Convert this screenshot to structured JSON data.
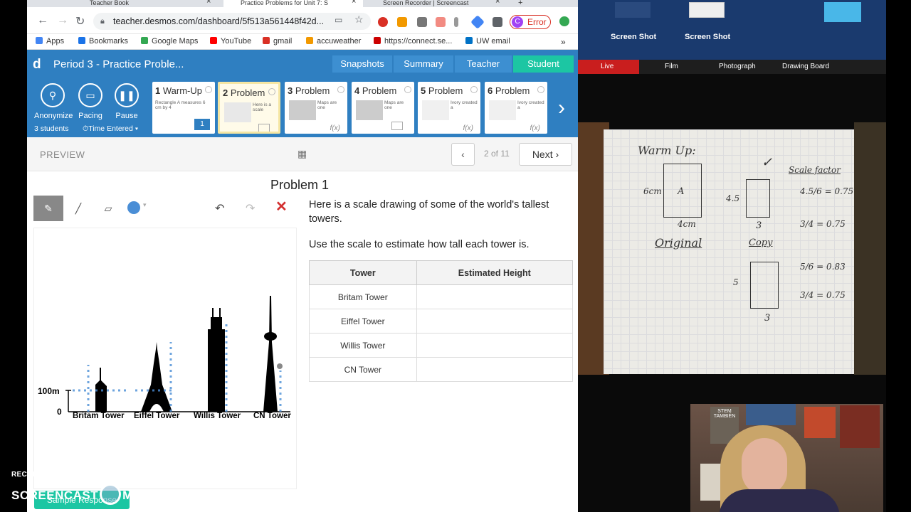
{
  "browser": {
    "tabs": [
      {
        "title": "Teacher Book"
      },
      {
        "title": "Practice Problems for Unit 7: S"
      },
      {
        "title": "Screen Recorder | Screencast"
      }
    ],
    "url": "teacher.desmos.com/dashboard/5f513a561448f42d...",
    "profile_letter": "C",
    "profile_status": "Error",
    "bookmarks": [
      "Apps",
      "Bookmarks",
      "Google Maps",
      "YouTube",
      "gmail",
      "accuweather",
      "https://connect.se...",
      "UW email"
    ],
    "bookmark_colors": [
      "#4285f4",
      "#1a73e8",
      "#34a853",
      "#ff0000",
      "#d93025",
      "#f29900",
      "#cc0000",
      "#0072c6"
    ]
  },
  "desmos": {
    "logo": "d",
    "title": "Period 3 - Practice Proble...",
    "header_tabs": [
      "Snapshots",
      "Summary",
      "Teacher",
      "Student"
    ],
    "selected_tab": "Student",
    "controls": {
      "anonymize": "Anonymize",
      "pacing": "Pacing",
      "pause": "Pause"
    },
    "students": "3 students",
    "time_entered": "Time Entered",
    "screens": [
      {
        "num": "1",
        "label": "Warm-Up",
        "desc": "Rectangle A measures 6 cm by 4",
        "badge": "1"
      },
      {
        "num": "2",
        "label": "Problem",
        "desc": "Here is a scale"
      },
      {
        "num": "3",
        "label": "Problem",
        "desc": "Maps are one",
        "fx": "f(x)"
      },
      {
        "num": "4",
        "label": "Problem",
        "desc": "Maps are one"
      },
      {
        "num": "5",
        "label": "Problem",
        "desc": "Ivory created a",
        "fx": "f(x)"
      },
      {
        "num": "6",
        "label": "Problem",
        "desc": "Ivory created a",
        "fx": "f(x)"
      }
    ],
    "preview_label": "PREVIEW",
    "page_count": "2 of 11",
    "next_label": "Next",
    "problem_title": "Problem 1",
    "prompt_1": "Here is a scale drawing of some of the world's tallest towers.",
    "prompt_2": "Use the scale to estimate how tall each tower is.",
    "table": {
      "headers": [
        "Tower",
        "Estimated Height"
      ],
      "rows": [
        "Britam Tower",
        "Eiffel Tower",
        "Willis Tower",
        "CN Tower"
      ]
    },
    "drawing": {
      "scale_top": "100m",
      "scale_bottom": "0",
      "tower_labels": [
        "Britam Tower",
        "Eiffel Tower",
        "Willis Tower",
        "CN Tower"
      ]
    },
    "sample_response": "Sample Response"
  },
  "desktop": {
    "screenshots": [
      "Screen Shot",
      "Screen Shot"
    ],
    "app_bar": [
      "Live",
      "Film",
      "Photograph",
      "Drawing Board"
    ]
  },
  "notebook": {
    "heading": "Warm Up:",
    "rect_a": "A",
    "label_6cm": "6cm",
    "label_4cm": "4cm",
    "original": "Original",
    "copy": "Copy",
    "scale_factor": "Scale factor",
    "sides": {
      "side_45": "4.5",
      "side_3a": "3",
      "side_5": "5",
      "side_3b": "3"
    },
    "eq1": "4.5/6 = 0.75",
    "eq2": "3/4 = 0.75",
    "eq3": "5/6 = 0.83",
    "eq4": "3/4 = 0.75"
  },
  "webcam": {
    "poster_text": "STEM TAMBIÉN"
  },
  "watermark": {
    "line1": "RECORDED WITH",
    "line2_a": "SCREENCAST",
    "line2_b": "MATIC"
  }
}
